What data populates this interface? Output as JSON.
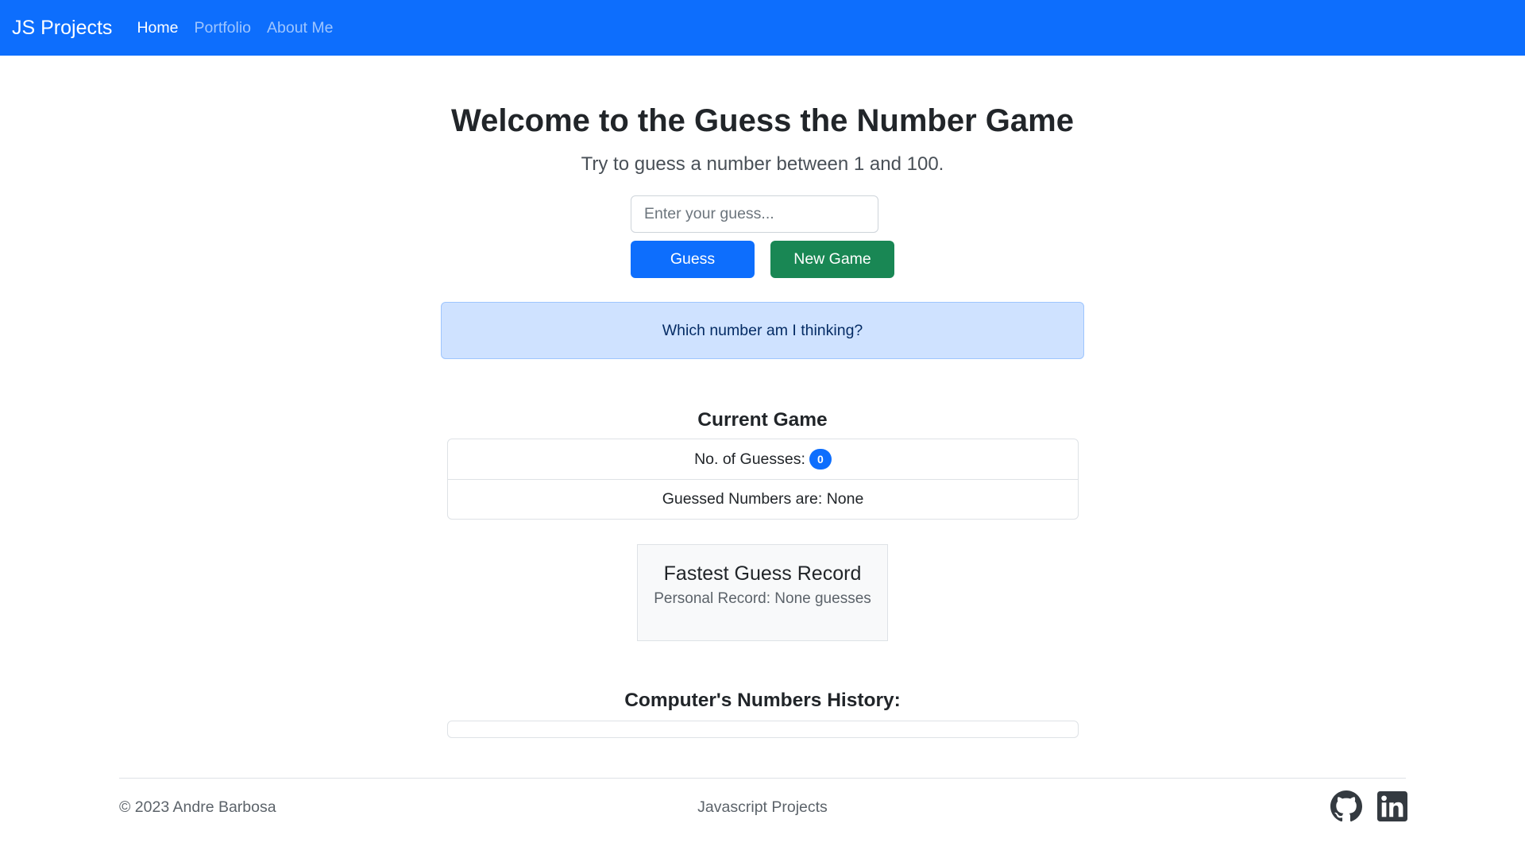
{
  "navbar": {
    "brand": "JS Projects",
    "links": [
      {
        "label": "Home",
        "active": true
      },
      {
        "label": "Portfolio",
        "active": false
      },
      {
        "label": "About Me",
        "active": false
      }
    ],
    "background": "#0d6efd"
  },
  "main": {
    "title": "Welcome to the Guess the Number Game",
    "subtitle": "Try to guess a number between 1 and 100.",
    "guess_input": {
      "value": "",
      "placeholder": "Enter your guess..."
    },
    "guess_button": "Guess",
    "new_game_button": "New Game",
    "alert_message": "Which number am I thinking?"
  },
  "current_game": {
    "heading": "Current Game",
    "guesses_label": "No. of Guesses:",
    "guesses_count": "0",
    "guessed_numbers": "Guessed Numbers are: None"
  },
  "record": {
    "title": "Fastest Guess Record",
    "text": "Personal Record: None guesses"
  },
  "history": {
    "heading": "Computer's Numbers History:",
    "items": []
  },
  "footer": {
    "copyright": "© 2023 Andre Barbosa",
    "center_text": "Javascript Projects",
    "icons": [
      "github-icon",
      "linkedin-icon"
    ]
  },
  "colors": {
    "primary": "#0d6efd",
    "success": "#198754",
    "alert_bg": "#cfe2ff"
  }
}
